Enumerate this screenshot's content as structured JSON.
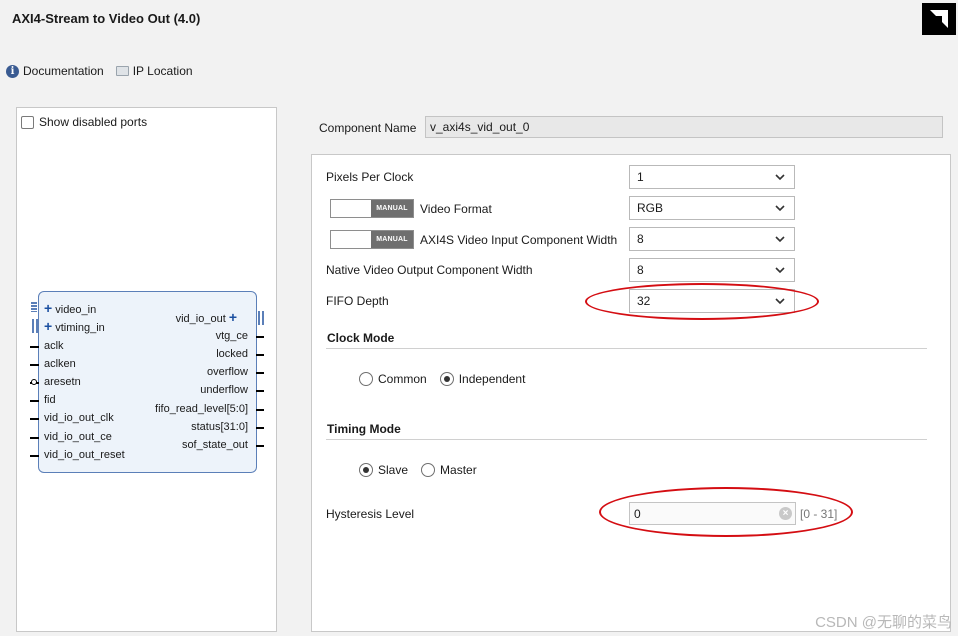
{
  "window": {
    "title": "AXI4-Stream to Video Out (4.0)"
  },
  "toolbar": {
    "documentation": "Documentation",
    "ip_location": "IP Location"
  },
  "left_panel": {
    "show_disabled_ports": "Show disabled ports"
  },
  "block": {
    "left_ports": [
      {
        "name": "video_in",
        "bus": true
      },
      {
        "name": "vtiming_in",
        "bus": true
      },
      {
        "name": "aclk",
        "bus": false
      },
      {
        "name": "aclken",
        "bus": false
      },
      {
        "name": "aresetn",
        "bus": false
      },
      {
        "name": "fid",
        "bus": false
      },
      {
        "name": "vid_io_out_clk",
        "bus": false
      },
      {
        "name": "vid_io_out_ce",
        "bus": false
      },
      {
        "name": "vid_io_out_reset",
        "bus": false
      }
    ],
    "right_ports": [
      {
        "name": "vid_io_out",
        "bus": true
      },
      {
        "name": "vtg_ce",
        "bus": false
      },
      {
        "name": "locked",
        "bus": false
      },
      {
        "name": "overflow",
        "bus": false
      },
      {
        "name": "underflow",
        "bus": false
      },
      {
        "name": "fifo_read_level[5:0]",
        "bus": false
      },
      {
        "name": "status[31:0]",
        "bus": false
      },
      {
        "name": "sof_state_out",
        "bus": false
      }
    ]
  },
  "component": {
    "label": "Component Name",
    "value": "v_axi4s_vid_out_0"
  },
  "params": {
    "pixels_per_clock": {
      "label": "Pixels Per Clock",
      "value": "1"
    },
    "video_format": {
      "label": "Video Format",
      "value": "RGB",
      "manual": "MANUAL"
    },
    "axi4s_width": {
      "label": "AXI4S Video Input Component Width",
      "value": "8",
      "manual": "MANUAL"
    },
    "native_width": {
      "label": "Native Video Output Component Width",
      "value": "8"
    },
    "fifo_depth": {
      "label": "FIFO Depth",
      "value": "32"
    }
  },
  "clock_mode": {
    "title": "Clock Mode",
    "options": [
      "Common",
      "Independent"
    ],
    "selected": "Independent"
  },
  "timing_mode": {
    "title": "Timing Mode",
    "options": [
      "Slave",
      "Master"
    ],
    "selected": "Slave"
  },
  "hysteresis": {
    "label": "Hysteresis Level",
    "value": "0",
    "range": "[0 - 31]"
  },
  "watermark": "CSDN @无聊的菜鸟",
  "colors": {
    "highlight": "#d40d12",
    "block_border": "#5b7fb8",
    "block_fill": "#edf3fa"
  }
}
